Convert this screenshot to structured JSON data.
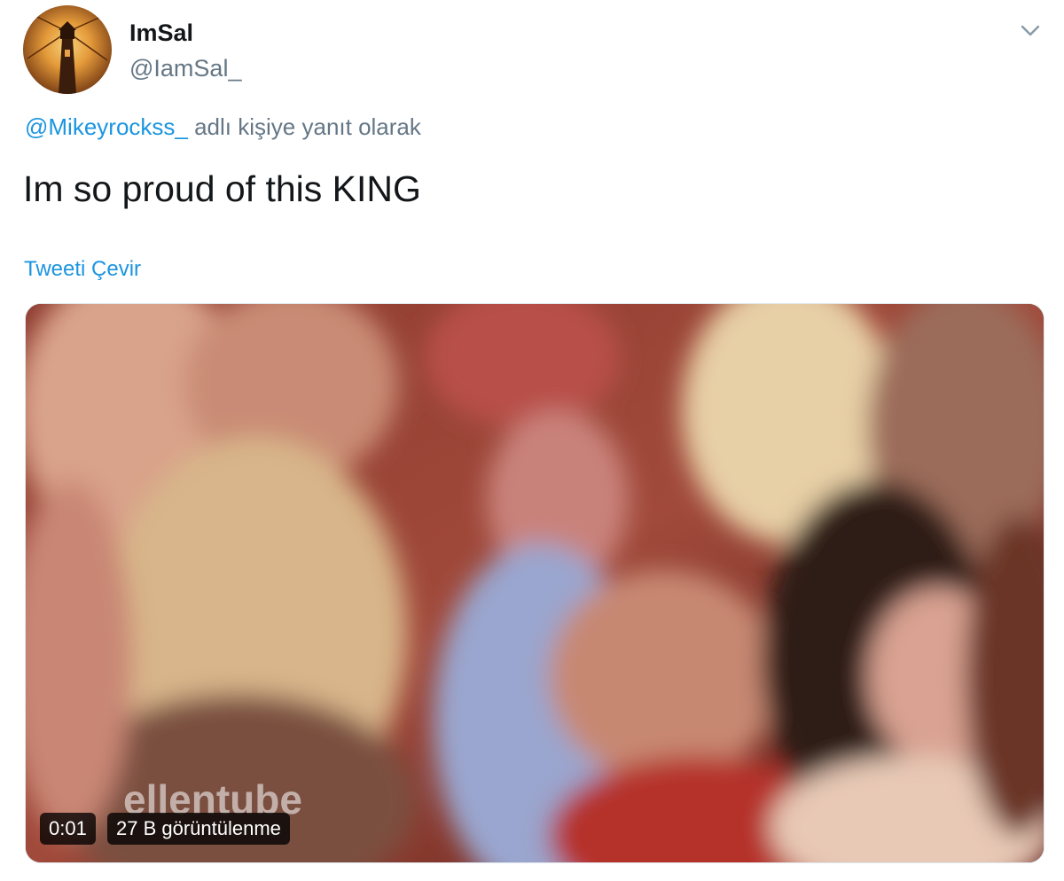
{
  "author": {
    "display_name": "ImSal",
    "handle": "@IamSal_",
    "avatar_icon": "lighthouse-avatar"
  },
  "reply": {
    "mention": "@Mikeyrockss_",
    "suffix": " adlı kişiye yanıt olarak"
  },
  "tweet": {
    "text": "Im so proud of this KING",
    "translate_label": "Tweeti Çevir"
  },
  "media": {
    "watermark": "ellentube",
    "duration": "0:01",
    "views": "27 B görüntülenme"
  },
  "colors": {
    "link": "#1b95e0",
    "secondary_text": "#657786",
    "primary_text": "#14171a"
  },
  "icons": {
    "menu": "chevron-down-icon"
  }
}
